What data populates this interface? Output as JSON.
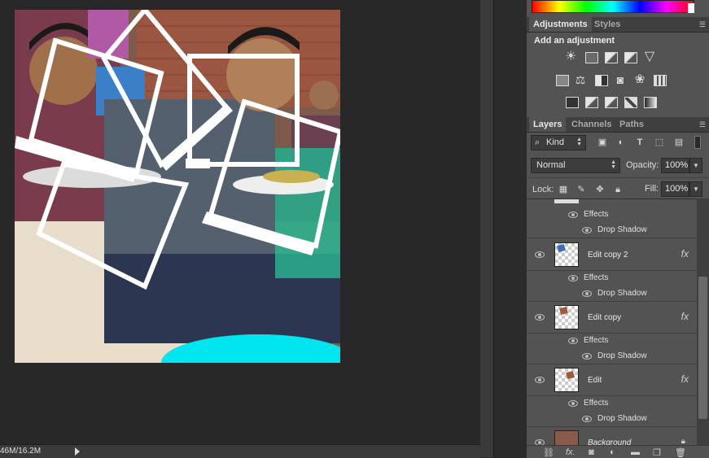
{
  "status": {
    "doc_size": "46M/16.2M"
  },
  "adjustments": {
    "tabs": [
      "Adjustments",
      "Styles"
    ],
    "title": "Add an adjustment",
    "icons_row1": [
      "brightness-contrast-icon",
      "levels-icon",
      "curves-icon",
      "exposure-icon",
      "vibrance-icon"
    ],
    "icons_row2": [
      "hue-saturation-icon",
      "color-balance-icon",
      "black-white-icon",
      "photo-filter-icon",
      "channel-mixer-icon",
      "color-lookup-icon"
    ],
    "icons_row3": [
      "invert-icon",
      "posterize-icon",
      "threshold-icon",
      "selective-color-icon",
      "gradient-map-icon"
    ]
  },
  "layers_panel": {
    "tabs": [
      "Layers",
      "Channels",
      "Paths"
    ],
    "kind_label": "Kind",
    "blend_mode": "Normal",
    "opacity_label": "Opacity:",
    "opacity_value": "100%",
    "lock_label": "Lock:",
    "fill_label": "Fill:",
    "fill_value": "100%",
    "effects_label": "Effects",
    "drop_shadow_label": "Drop Shadow",
    "layers": [
      {
        "name": "Edit copy 2",
        "fx": "fx"
      },
      {
        "name": "Edit copy",
        "fx": "fx"
      },
      {
        "name": "Edit",
        "fx": "fx"
      },
      {
        "name": "Background"
      }
    ]
  },
  "colors": {
    "workspace_bg": "#282828",
    "panel_bg": "#535353",
    "tab_bar_bg": "#3f3f3f",
    "photo_accent_cyan": "#00e5f0"
  }
}
